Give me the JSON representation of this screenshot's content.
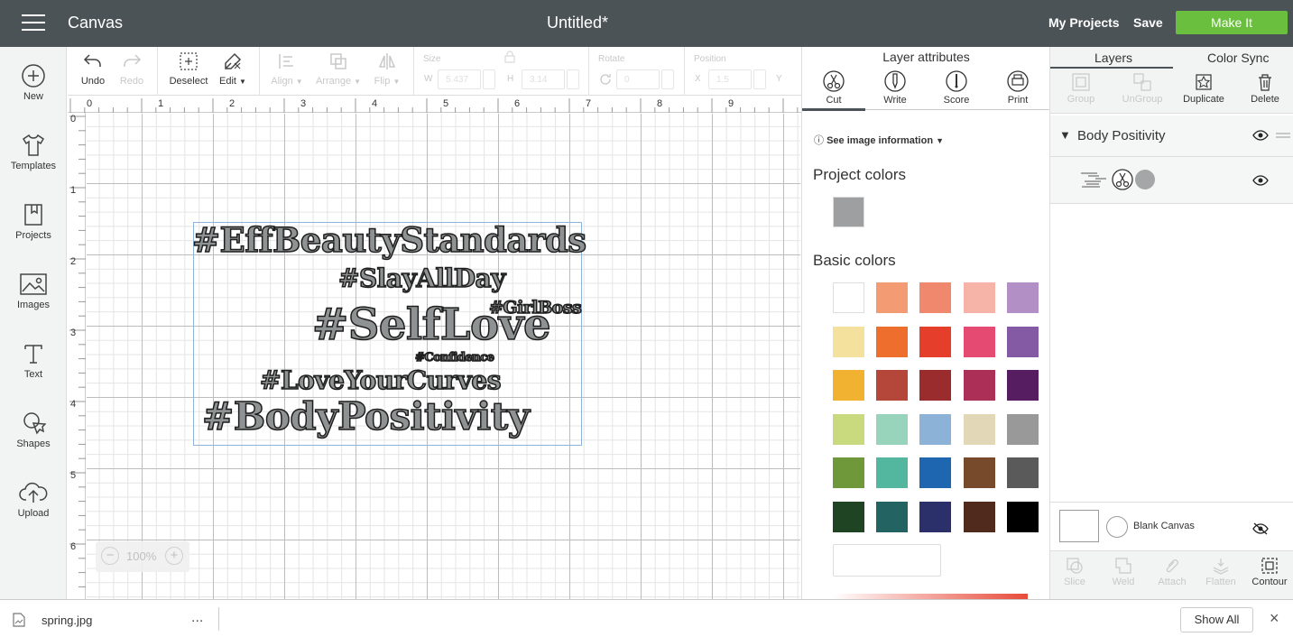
{
  "header": {
    "app_title": "Canvas",
    "doc_title": "Untitled*",
    "my_projects": "My Projects",
    "save": "Save",
    "make_it": "Make It"
  },
  "sidebar": {
    "items": [
      {
        "label": "New",
        "icon": "plus-circle-icon"
      },
      {
        "label": "Templates",
        "icon": "shirt-icon"
      },
      {
        "label": "Projects",
        "icon": "bookmark-icon"
      },
      {
        "label": "Images",
        "icon": "image-icon"
      },
      {
        "label": "Text",
        "icon": "text-t-icon"
      },
      {
        "label": "Shapes",
        "icon": "shapes-icon"
      },
      {
        "label": "Upload",
        "icon": "cloud-upload-icon"
      }
    ]
  },
  "toolbar": {
    "undo": "Undo",
    "redo": "Redo",
    "deselect": "Deselect",
    "edit": "Edit",
    "align": "Align",
    "arrange": "Arrange",
    "flip": "Flip",
    "size": "Size",
    "w": "W",
    "h": "H",
    "w_value": "5.437",
    "h_value": "3.14",
    "rotate": "Rotate",
    "rotate_value": "0",
    "position": "Position",
    "x": "X",
    "y": "Y",
    "x_value": "1.5"
  },
  "rulers": {
    "top": [
      "0",
      "1",
      "2",
      "3",
      "4",
      "5",
      "6",
      "7",
      "8",
      "9"
    ],
    "left": [
      "0",
      "1",
      "2",
      "3",
      "4",
      "5",
      "6"
    ]
  },
  "canvas": {
    "hashtags": [
      "#EffBeautyStandards",
      "#SlayAllDay",
      "#GirlBoss",
      "#SelfLove",
      "#Confidence",
      "#LoveYourCurves",
      "#BodyPositivity"
    ],
    "zoom_value": "100%"
  },
  "attributes": {
    "title": "Layer attributes",
    "tabs": [
      {
        "label": "Cut",
        "icon": "scissors-icon"
      },
      {
        "label": "Write",
        "icon": "pen-icon"
      },
      {
        "label": "Score",
        "icon": "score-icon"
      },
      {
        "label": "Print",
        "icon": "printer-icon"
      }
    ],
    "see_info": "See image information",
    "project_colors_label": "Project colors",
    "project_colors": [
      "#9d9fa0"
    ],
    "basic_colors_label": "Basic colors",
    "basic_colors": [
      "#ffffff",
      "#f39c74",
      "#f0886e",
      "#f6b3a8",
      "#b28fc4",
      "#f3e19d",
      "#ee6f2d",
      "#e53f2c",
      "#e54a73",
      "#845aa5",
      "#f1b232",
      "#b5473a",
      "#9b2c2e",
      "#ab2f56",
      "#561d61",
      "#c9d97e",
      "#98d4bb",
      "#8db2d8",
      "#e2d8b8",
      "#999999",
      "#6e983a",
      "#52b79e",
      "#1f66b1",
      "#764a2a",
      "#5a5a5a",
      "#1f4424",
      "#236362",
      "#2b2f6a",
      "#4f2a1d",
      "#000000"
    ]
  },
  "layers": {
    "tab_layers": "Layers",
    "tab_color_sync": "Color Sync",
    "actions": [
      {
        "label": "Group",
        "enabled": false
      },
      {
        "label": "UnGroup",
        "enabled": false
      },
      {
        "label": "Duplicate",
        "enabled": true
      },
      {
        "label": "Delete",
        "enabled": true
      }
    ],
    "group_name": "Body Positivity",
    "blank_canvas": "Blank Canvas",
    "tools": [
      {
        "label": "Slice",
        "enabled": false
      },
      {
        "label": "Weld",
        "enabled": false
      },
      {
        "label": "Attach",
        "enabled": false
      },
      {
        "label": "Flatten",
        "enabled": false
      },
      {
        "label": "Contour",
        "enabled": true
      }
    ]
  },
  "download_bar": {
    "filename": "spring.jpg",
    "more": "...",
    "show_all": "Show All",
    "close": "×"
  }
}
